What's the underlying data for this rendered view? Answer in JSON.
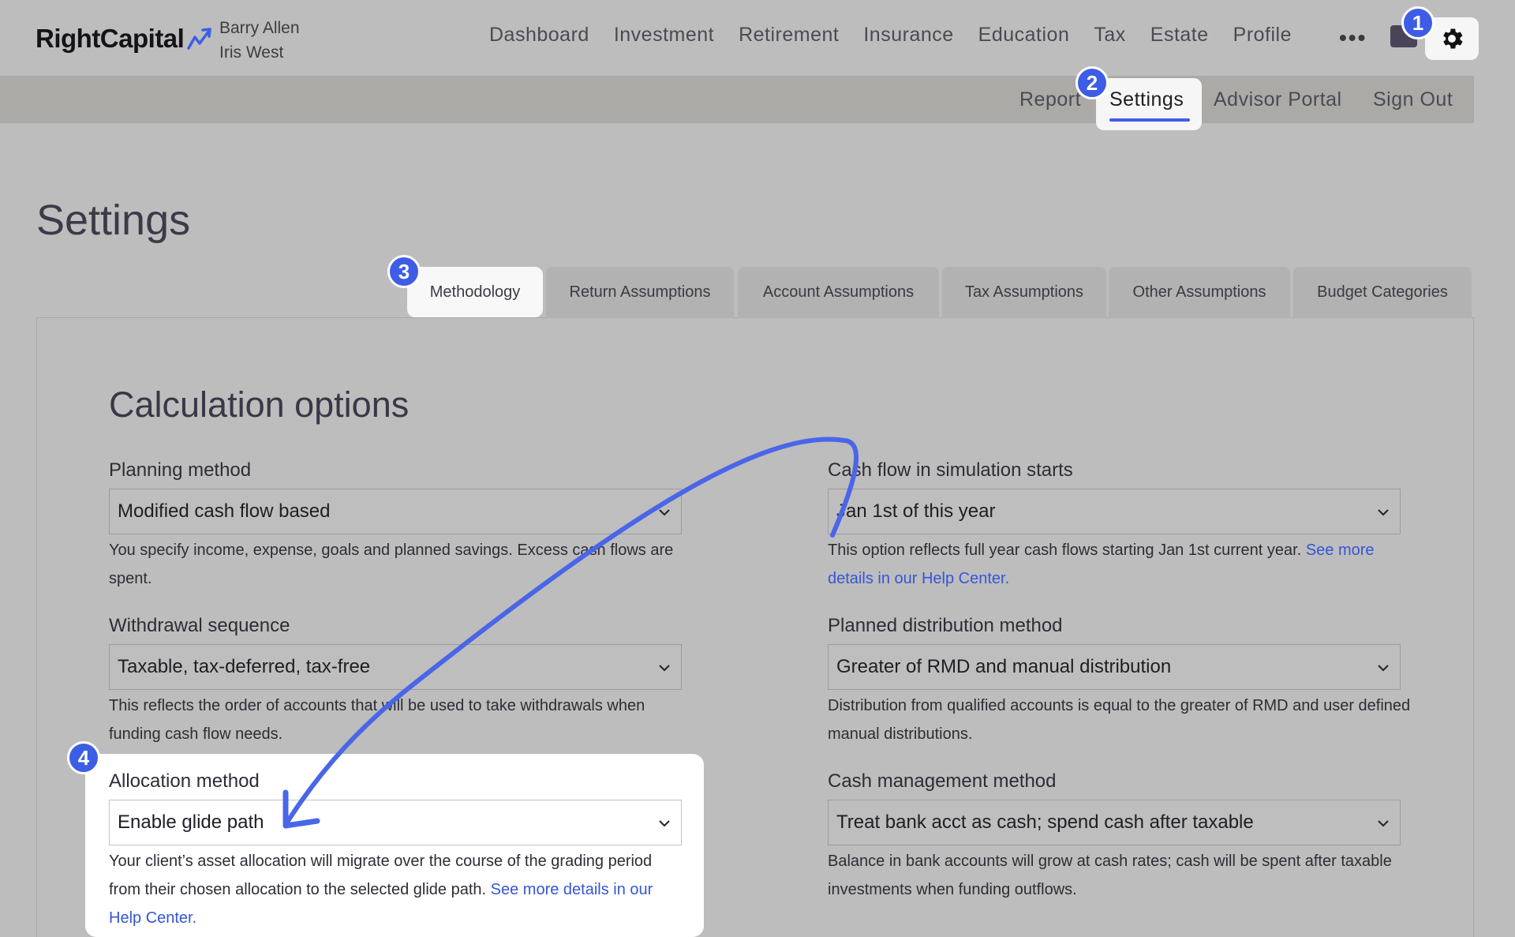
{
  "brand": {
    "name": "RightCapital",
    "accent": "#3d5de6"
  },
  "clients": [
    "Barry Allen",
    "Iris West"
  ],
  "main_nav": [
    "Dashboard",
    "Investment",
    "Retirement",
    "Insurance",
    "Education",
    "Tax",
    "Estate",
    "Profile"
  ],
  "more_icon": "•••",
  "icons": {
    "mail": "mail-icon",
    "settings": "gear-icon",
    "chevron": "chevron-down-icon",
    "arrow": "annotation-arrow"
  },
  "sub_nav": {
    "report": "Report",
    "settings": "Settings",
    "advisor_portal": "Advisor Portal",
    "sign_out": "Sign Out"
  },
  "page_title": "Settings",
  "tabs": [
    "Methodology",
    "Return Assumptions",
    "Account Assumptions",
    "Tax Assumptions",
    "Other Assumptions",
    "Budget Categories"
  ],
  "section_title": "Calculation options",
  "fields": {
    "planning_method": {
      "label": "Planning method",
      "value": "Modified cash flow based",
      "help": "You specify income, expense, goals and planned savings. Excess cash flows are spent."
    },
    "withdrawal_sequence": {
      "label": "Withdrawal sequence",
      "value": "Taxable, tax-deferred, tax-free",
      "help": "This reflects the order of accounts that will be used to take withdrawals when funding cash flow needs."
    },
    "allocation_method": {
      "label": "Allocation method",
      "value": "Enable glide path",
      "help": "Your client’s asset allocation will migrate over the course of the grading period from their chosen allocation to the selected glide path.",
      "link": "See more details in our Help Center."
    },
    "cash_flow_start": {
      "label": "Cash flow in simulation starts",
      "value": "Jan 1st of this year",
      "help": "This option reflects full year cash flows starting Jan 1st current year.",
      "link": "See more details in our Help Center."
    },
    "planned_distribution": {
      "label": "Planned distribution method",
      "value": "Greater of RMD and manual distribution",
      "help": "Distribution from qualified accounts is equal to the greater of RMD and user defined manual distributions."
    },
    "cash_management": {
      "label": "Cash management method",
      "value": "Treat bank acct as cash; spend cash after taxable",
      "help": "Balance in bank accounts will grow at cash rates; cash will be spent after taxable investments when funding outflows."
    }
  },
  "step_badges": [
    "1",
    "2",
    "3",
    "4"
  ]
}
